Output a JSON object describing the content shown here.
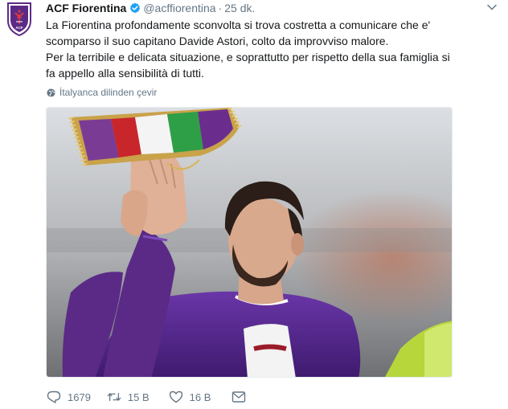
{
  "tweet": {
    "author_name": "ACF Fiorentina",
    "handle": "@acffiorentina",
    "separator": "·",
    "timestamp": "25 dk.",
    "text_lines": [
      "La Fiorentina profondamente sconvolta si trova costretta a comunicare che e'",
      "scomparso il suo capitano Davide Astori, colto da improvviso malore.",
      "Per la terribile e delicata situazione,  e soprattutto per rispetto della sua famiglia si",
      "fa appello alla sensibilità di tutti."
    ],
    "translate_label": "İtalyanca dilinden çevir"
  },
  "actions": {
    "reply_count": "1679",
    "retweet_count": "15 B",
    "like_count": "16 B"
  },
  "colors": {
    "text": "#14171a",
    "secondary": "#657786",
    "verified": "#1da1f2",
    "fiorentina_purple": "#5b2a86"
  },
  "icons": {
    "avatar": "fiorentina-crest-icon",
    "verified": "verified-badge-icon",
    "menu": "chevron-down-icon",
    "translate": "globe-icon",
    "reply": "reply-icon",
    "retweet": "retweet-icon",
    "like": "heart-icon",
    "dm": "envelope-icon"
  }
}
